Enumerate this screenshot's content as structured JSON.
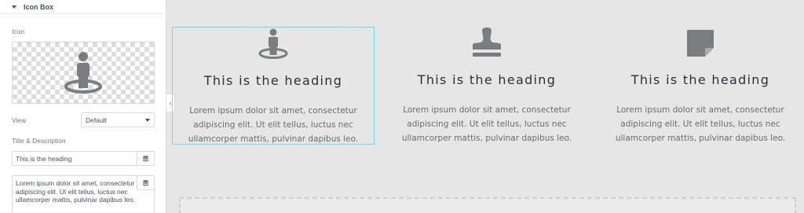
{
  "panel": {
    "section_title": "Icon Box",
    "icon_label": "Icon",
    "view_label": "View",
    "view_value": "Default",
    "title_desc_label": "Title & Description",
    "title_value": "This is the heading",
    "description_value": "Lorem ipsum dolor sit amet, consectetur adipiscing elit. Ut elit tellus, luctus nec ullamcorper mattis, pulvinar dapibus leo."
  },
  "icons": {
    "preview": "person-on-pin-icon",
    "database": "database-icon"
  },
  "boxes": [
    {
      "icon": "person-on-pin-icon",
      "heading": "This is the heading",
      "description": "Lorem ipsum dolor sit amet, consectetur adipiscing elit. Ut elit tellus, luctus nec ullamcorper mattis, pulvinar dapibus leo."
    },
    {
      "icon": "stamp-icon",
      "heading": "This is the heading",
      "description": "Lorem ipsum dolor sit amet, consectetur adipiscing elit. Ut elit tellus, luctus nec ullamcorper mattis, pulvinar dapibus leo."
    },
    {
      "icon": "sticky-note-icon",
      "heading": "This is the heading",
      "description": "Lorem ipsum dolor sit amet, consectetur adipiscing elit. Ut elit tellus, luctus nec ullamcorper mattis, pulvinar dapibus leo."
    }
  ],
  "colors": {
    "icon": "#7a7d80",
    "selection": "#71d7f7",
    "heading": "#2b3037",
    "text": "#6b6b6b"
  }
}
